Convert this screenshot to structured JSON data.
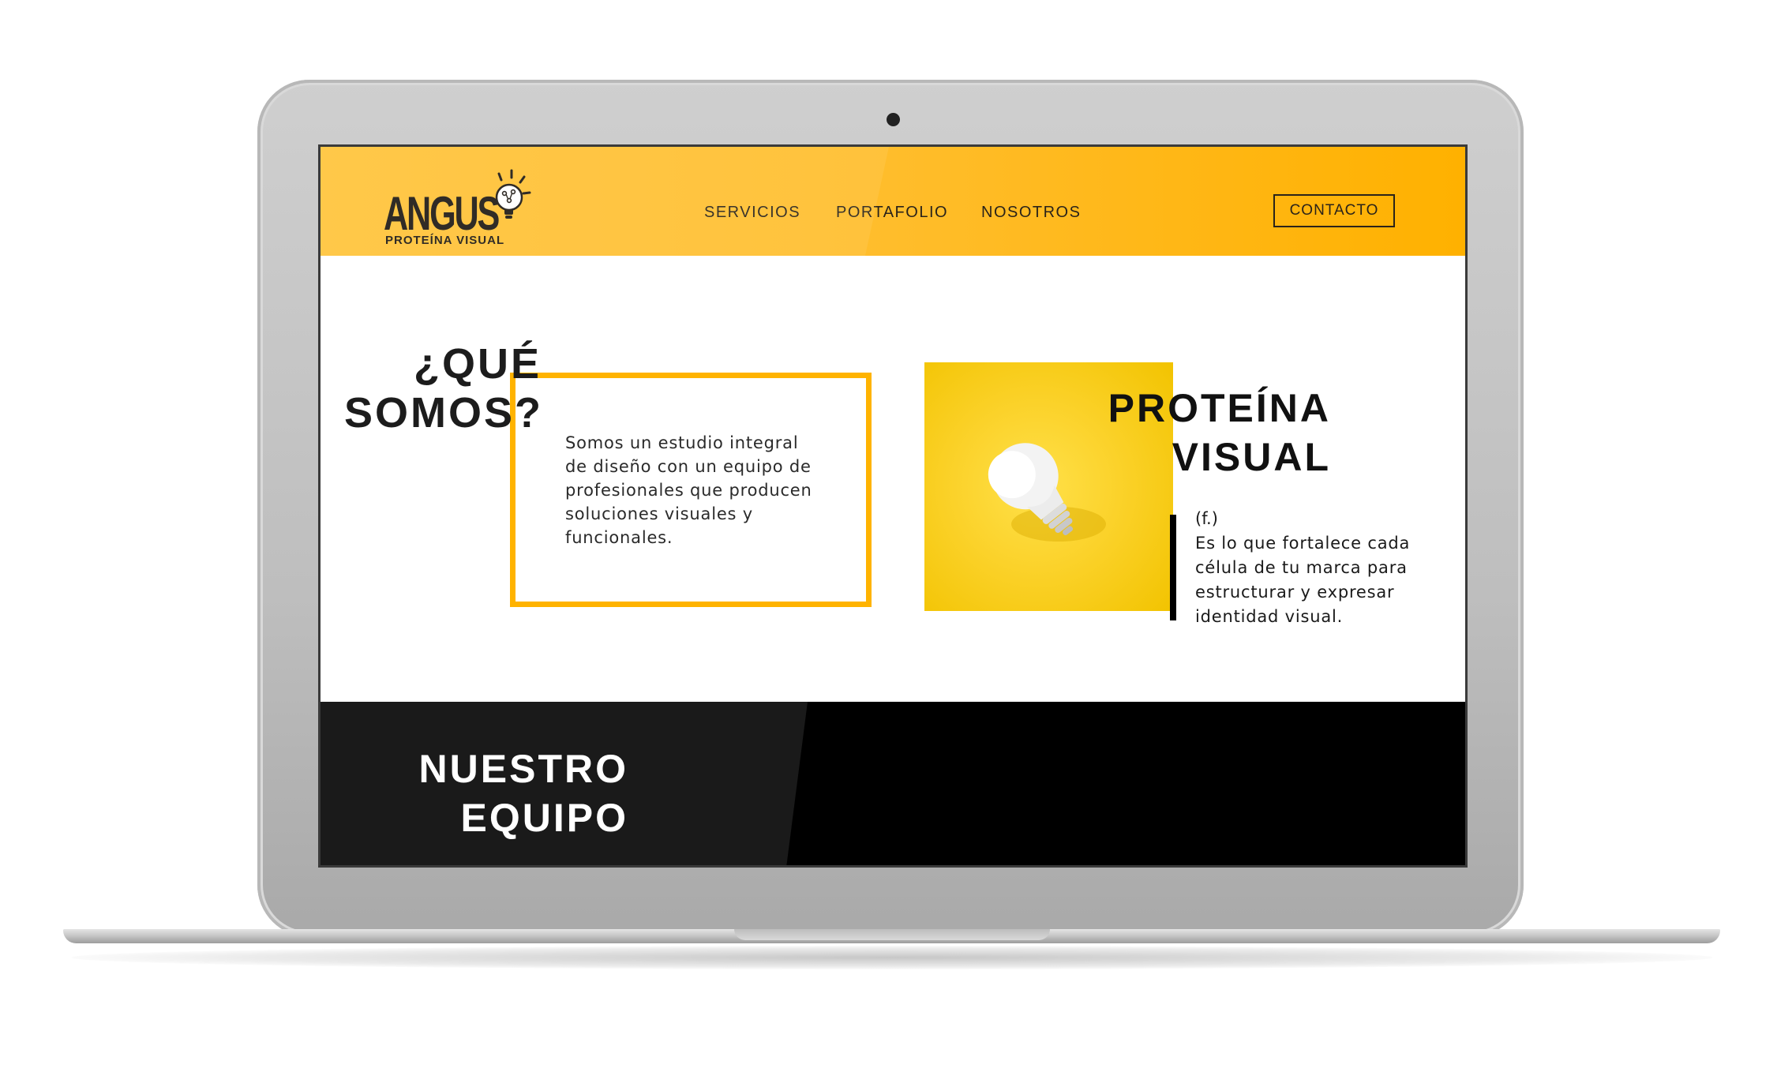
{
  "header": {
    "logo_word": "ANGUS",
    "logo_tagline": "PROTEÍNA VISUAL",
    "nav": [
      "SERVICIOS",
      "PORTAFOLIO",
      "NOSOTROS"
    ],
    "contact_label": "CONTACTO"
  },
  "about": {
    "title_line1": "¿QUÉ",
    "title_line2": "SOMOS?",
    "lines": [
      "Somos un estudio integral",
      "de diseño con un equipo de",
      "profesionales que producen",
      "soluciones visuales y",
      "funcionales."
    ]
  },
  "protein": {
    "title_line1": "PROTEÍNA",
    "title_line2": "VISUAL",
    "word_class": "(f.)",
    "lines": [
      "Es lo que fortalece cada",
      "célula de tu marca para",
      "estructurar y expresar",
      "identidad visual."
    ],
    "photo_icon": "lightbulb-icon"
  },
  "team": {
    "title_line1": "NUESTRO",
    "title_line2": "EQUIPO"
  },
  "colors": {
    "accent": "#ffb300",
    "header_start": "#ffc43a",
    "header_end": "#ffb100",
    "photo_yellow": "#fbd22a",
    "dark": "#000000"
  }
}
